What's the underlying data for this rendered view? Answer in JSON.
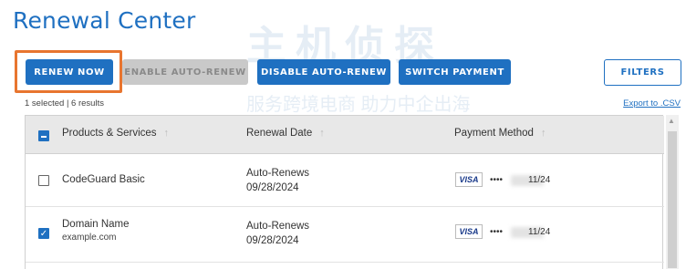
{
  "page": {
    "title": "Renewal Center"
  },
  "toolbar": {
    "renew_now": "RENEW NOW",
    "enable_auto_renew": "ENABLE AUTO-RENEW",
    "disable_auto_renew": "DISABLE AUTO-RENEW",
    "switch_payment": "SWITCH PAYMENT",
    "filters": "FILTERS"
  },
  "selection": {
    "summary": "1 selected | 6 results",
    "export": "Export to .CSV"
  },
  "table": {
    "headers": {
      "products": "Products & Services",
      "renewal_date": "Renewal Date",
      "payment_method": "Payment Method"
    },
    "rows": [
      {
        "name": "CodeGuard Basic",
        "domain": "",
        "renewal_status": "Auto-Renews",
        "date": "09/28/2024",
        "card_brand": "VISA",
        "card_mask": "••••",
        "card_exp": "11/24",
        "checked": false
      },
      {
        "name": "Domain Name",
        "domain": "example.com",
        "renewal_status": "Auto-Renews",
        "date": "09/28/2024",
        "card_brand": "VISA",
        "card_mask": "••••",
        "card_exp": "11/24",
        "checked": true
      }
    ]
  },
  "watermark": {
    "line1": "主机侦探",
    "line2": "服务跨境电商 助力中企出海"
  },
  "colors": {
    "accent": "#1f70c1",
    "highlight": "#e8752f",
    "disabled": "#c9c9c9"
  }
}
